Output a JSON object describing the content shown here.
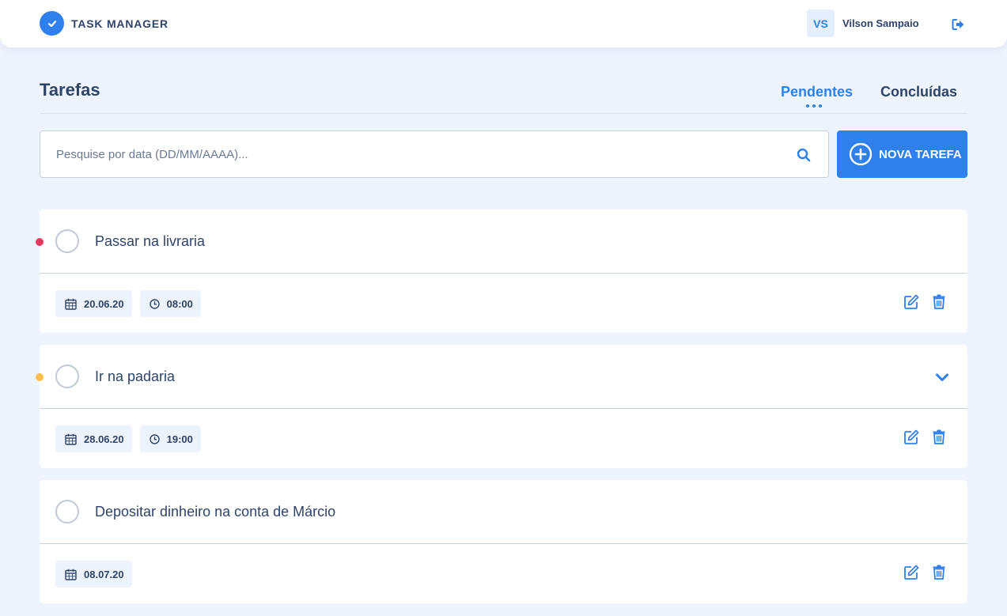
{
  "header": {
    "app_title": "TASK MANAGER",
    "user_initials": "VS",
    "user_name": "Vilson Sampaio"
  },
  "main": {
    "title": "Tarefas",
    "tabs": [
      {
        "label": "Pendentes",
        "active": true
      },
      {
        "label": "Concluídas",
        "active": false
      }
    ],
    "search": {
      "placeholder": "Pesquise por data (DD/MM/AAAA)...",
      "value": ""
    },
    "new_task_label": "NOVA TAREFA"
  },
  "colors": {
    "accent": "#2f80ed",
    "text": "#2f4468",
    "background": "#eef4fd",
    "priority_high": "#e5395e",
    "priority_medium": "#fdbe4a"
  },
  "icons": {
    "brand": "check-circle-icon",
    "logout": "sign-out-icon",
    "search": "search-icon",
    "new_task": "plus-circle-icon",
    "date": "calendar-icon",
    "time": "clock-icon",
    "edit": "edit-icon",
    "delete": "trash-icon",
    "expand": "chevron-down-icon"
  },
  "tasks": [
    {
      "title": "Passar na livraria",
      "date": "20.06.20",
      "time": "08:00",
      "priority": "high",
      "expandable": false
    },
    {
      "title": "Ir na padaria",
      "date": "28.06.20",
      "time": "19:00",
      "priority": "medium",
      "expandable": true
    },
    {
      "title": "Depositar dinheiro na conta de Márcio",
      "date": "08.07.20",
      "time": "",
      "priority": "none",
      "expandable": false
    }
  ]
}
